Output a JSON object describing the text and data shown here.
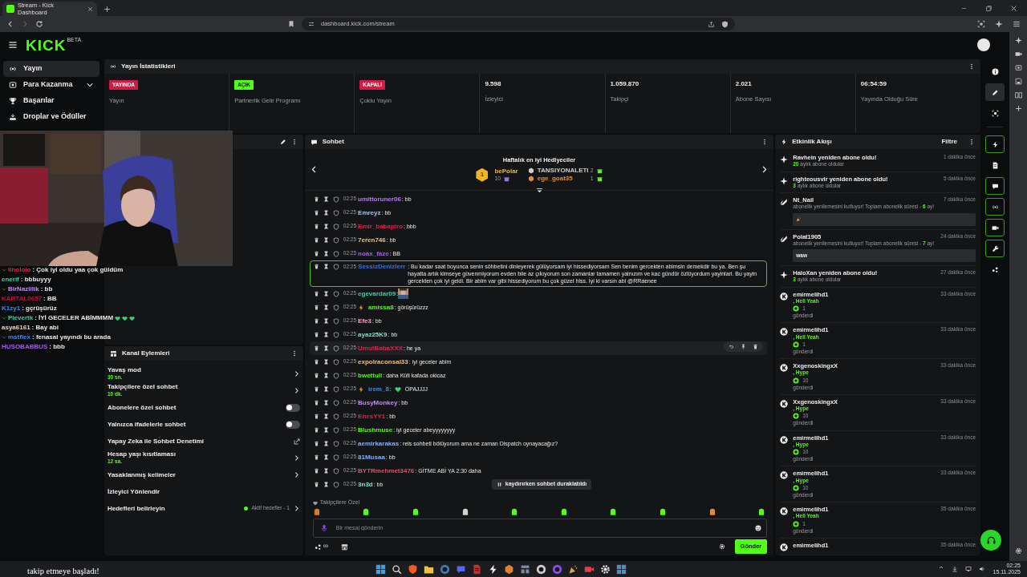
{
  "browser": {
    "tab_title": "Stream - Kick Dashboard",
    "url": "dashboard.kick.com/stream"
  },
  "header": {
    "logo": "KICK",
    "logo_badge": "BETA"
  },
  "sidebar": {
    "items": [
      {
        "kind": "broadcast",
        "label": "Yayın",
        "selected": true,
        "expandable": false
      },
      {
        "kind": "wallet",
        "label": "Para Kazanma",
        "selected": false,
        "expandable": true
      },
      {
        "kind": "trophy",
        "label": "Başarılar",
        "selected": false,
        "expandable": false
      },
      {
        "kind": "drops",
        "label": "Droplar ve Ödüller",
        "selected": false,
        "expandable": false
      }
    ]
  },
  "stats": {
    "title": "Yayın İstatistikleri",
    "cells": [
      {
        "kind": "badge",
        "value": "YAYINDA",
        "color": "#d01c44",
        "label": "Yayın"
      },
      {
        "kind": "badge",
        "value": "AÇIK",
        "color": "#53fc18",
        "label": "Partnerlik Gelir Programı"
      },
      {
        "kind": "badge",
        "value": "KAPALI",
        "color": "#d01c44",
        "label": "Çoklu Yayın"
      },
      {
        "kind": "number",
        "value": "9.598",
        "label": "İzleyici"
      },
      {
        "kind": "number",
        "value": "1.059.870",
        "label": "Takipçi"
      },
      {
        "kind": "number",
        "value": "2.021",
        "label": "Abone Sayısı"
      },
      {
        "kind": "number",
        "value": "06:54:59",
        "label": "Yayında Olduğu Süre"
      }
    ]
  },
  "rail": [
    {
      "kind": "info",
      "selected": false,
      "pinned": false
    },
    {
      "kind": "pencil",
      "selected": true,
      "pinned": false
    },
    {
      "kind": "scan",
      "selected": false,
      "pinned": false
    },
    {
      "kind": "bolt",
      "selected": false,
      "pinned": true
    },
    {
      "kind": "doc",
      "selected": false,
      "pinned": false
    },
    {
      "kind": "chat",
      "selected": false,
      "pinned": true
    },
    {
      "kind": "broadcast",
      "selected": false,
      "pinned": true
    },
    {
      "kind": "camera",
      "selected": false,
      "pinned": true
    },
    {
      "kind": "wrench",
      "selected": false,
      "pinned": true
    },
    {
      "kind": "nodes",
      "selected": false,
      "pinned": false
    }
  ],
  "webcam_overlay": {
    "chat": [
      {
        "kind": "text",
        "user": "linololo",
        "color": "#e0234e",
        "badge": true,
        "text": ": Çok iyi oldu yaa çok güldüm"
      },
      {
        "kind": "text",
        "user": "enerif",
        "color": "#3fd0a0",
        "badge": false,
        "text": ": bbbuyyy"
      },
      {
        "kind": "text",
        "user": "BirNazlilik",
        "color": "#c08cf0",
        "badge": true,
        "text": ": bb"
      },
      {
        "kind": "text",
        "user": "KARTAL0657",
        "color": "#c0143a",
        "badge": false,
        "text": ": BB"
      },
      {
        "kind": "text",
        "user": "K1zy1",
        "color": "#3a8cf0",
        "badge": false,
        "text": ": gçrüşürüz"
      },
      {
        "kind": "hearts",
        "user": "Plevertk",
        "color": "#3fd0a0",
        "badge": true,
        "text": ": İYİ GECELER ABİMMMM"
      },
      {
        "kind": "text",
        "user": "asya6161",
        "color": "#e8d0c0",
        "badge": false,
        "text": ": Bay abi"
      },
      {
        "kind": "text",
        "user": "mstflex",
        "color": "#3a8cf0",
        "badge": true,
        "text": ": fenasal yayındı bu arada"
      },
      {
        "kind": "text",
        "user": "HUSOBABBUS",
        "color": "#a35ce8",
        "badge": false,
        "text": ": bbb"
      }
    ]
  },
  "follow_alert": {
    "text": "takip etmeye başladı!"
  },
  "channel_actions": {
    "title": "Kanal Eylemleri",
    "items": [
      {
        "kind": "link",
        "label": "Yavaş mod",
        "value": "30 sn."
      },
      {
        "kind": "link",
        "label": "Takipçilere özel sohbet",
        "value": "10 dk."
      },
      {
        "kind": "toggle",
        "label": "Abonelere özel sohbet",
        "on": false
      },
      {
        "kind": "toggle",
        "label": "Yalnızca ifadelerle sohbet",
        "on": false
      },
      {
        "kind": "external",
        "label": "Yapay Zeka ile Sohbet Denetimi"
      },
      {
        "kind": "link",
        "label": "Hesap yaşı kısıtlaması",
        "value": "12 sa."
      },
      {
        "kind": "link",
        "label": "Yasaklanmış kelimeler"
      },
      {
        "kind": "plain",
        "label": "İzleyici Yönlendir"
      },
      {
        "kind": "link",
        "label": "Hedefleri belirleyin",
        "status": "Aktif hedefler - 1"
      }
    ]
  },
  "chat": {
    "title": "Sohbet",
    "gifters": {
      "title": "Haftalık en iyi Hediyeciler",
      "first": {
        "rank": "1",
        "name": "bePolar",
        "count": "10"
      },
      "others": [
        {
          "name": "TANSIYONALETI",
          "count": "2",
          "color": "#cfcfcf"
        },
        {
          "name": "ege_goat35",
          "count": "1",
          "color": "#e08a3c"
        }
      ]
    },
    "messages": [
      {
        "kind": "text",
        "time": "02:25",
        "user": "umittoruner06",
        "color": "#b57cf0",
        "badge": false,
        "text": ": bb",
        "highlighted": false,
        "hovered": false
      },
      {
        "kind": "text",
        "time": "02:25",
        "user": "Emreyz",
        "color": "#9ec3ff",
        "badge": false,
        "text": ": bb",
        "highlighted": false,
        "hovered": false
      },
      {
        "kind": "text",
        "time": "02:25",
        "user": "Emir_babapiro",
        "color": "#e0234e",
        "badge": false,
        "text": ": bbb",
        "highlighted": false,
        "hovered": false
      },
      {
        "kind": "text",
        "time": "02:25",
        "user": "7eren746",
        "color": "#f0c070",
        "badge": false,
        "text": ": bb",
        "highlighted": false,
        "hovered": false
      },
      {
        "kind": "text",
        "time": "02:25",
        "user": "noax_faze",
        "color": "#a35ce8",
        "badge": false,
        "text": ": BB",
        "highlighted": false,
        "hovered": false
      },
      {
        "kind": "text",
        "time": "02:25",
        "user": "SessizDenizlerr",
        "color": "#3a6fd8",
        "badge": false,
        "text": ": Bu kadar saat boyunca senin söhbetini dinleyerek gülüyorsam iyi hissediyorsam Sen benim gercekten abimsin demekdir bu ya. Ben şu hayatta artık kimseye güvenmiyorum evden bile az çıkıyorum son zamanlar tamamen yalnızım ve kac gündür özlüyordum yayinlari. Bu yayin gercekten çok iyi geldi. Bir abim var gibi hissediyorum bu çok güzel hiss. İyi ki varsın abi @RRaenee",
        "highlighted": true,
        "hovered": false
      },
      {
        "time": "02:25",
        "user": "egevardar09",
        "color": "#3fd0a0",
        "badge": false,
        "text": ":",
        "highlighted": false,
        "hovered": false
      },
      {
        "kind": "text",
        "time": "02:25",
        "user": "amissa8",
        "color": "#53fc18",
        "badge": true,
        "text": ": görüşürüzzz",
        "highlighted": false,
        "hovered": false
      },
      {
        "kind": "text",
        "time": "02:25",
        "user": "Efe3",
        "color": "#f0a0c0",
        "badge": false,
        "text": ": bb",
        "highlighted": false,
        "hovered": false
      },
      {
        "kind": "text",
        "time": "02:25",
        "user": "ayaz25K9",
        "color": "#7ee0d0",
        "badge": false,
        "text": ": bb",
        "highlighted": false,
        "hovered": false
      },
      {
        "kind": "text",
        "time": "02:25",
        "user": "UmutBabaXXX",
        "color": "#e0234e",
        "badge": false,
        "text": ": he ya",
        "highlighted": false,
        "hovered": true
      },
      {
        "kind": "text",
        "time": "02:25",
        "user": "expolraconsal33",
        "color": "#f0c070",
        "badge": false,
        "text": ": iyi geceler abim",
        "highlighted": false,
        "hovered": false
      },
      {
        "kind": "text",
        "time": "02:25",
        "user": "bwettull",
        "color": "#53fc18",
        "badge": false,
        "text": ": daha Küfi kafada okicaz",
        "highlighted": false,
        "hovered": false
      },
      {
        "kind": "heart",
        "time": "02:25",
        "user": "irem_8",
        "color": "#3a8cf0",
        "badge": true,
        "text": ":",
        "after": "ÖPAJJJJ",
        "highlighted": false,
        "hovered": false
      },
      {
        "kind": "text",
        "time": "02:25",
        "user": "BusyMonkey",
        "color": "#c08cf0",
        "badge": false,
        "text": ": bb",
        "highlighted": false,
        "hovered": false
      },
      {
        "kind": "text",
        "time": "02:25",
        "user": "EnesYY1",
        "color": "#e0234e",
        "badge": false,
        "text": ": bb",
        "highlighted": false,
        "hovered": false
      },
      {
        "kind": "text",
        "time": "02:25",
        "user": "Blushmuse",
        "color": "#53fc18",
        "badge": false,
        "text": ": iyi geceler abeyyyyyyyy",
        "highlighted": false,
        "hovered": false
      },
      {
        "kind": "text",
        "time": "02:25",
        "user": "aemirkarakas",
        "color": "#7eb0ff",
        "badge": false,
        "text": ": reis sohbeti bölüyorum ama ne zaman Dispatch oynayacağız?",
        "highlighted": false,
        "hovered": false
      },
      {
        "kind": "text",
        "time": "02:25",
        "user": "81Musaa",
        "color": "#7eb0ff",
        "badge": false,
        "text": ": bb",
        "highlighted": false,
        "hovered": false
      },
      {
        "kind": "text",
        "time": "02:25",
        "user": "BYTRmehmet3476",
        "color": "#e05070",
        "badge": false,
        "text": ": GİTME ABİ YA 2:30 daha",
        "highlighted": false,
        "hovered": false
      },
      {
        "kind": "text",
        "time": "02:25",
        "user": "3n3d",
        "color": "#7ee0d0",
        "badge": false,
        "text": ": bb",
        "highlighted": false,
        "hovered": false
      }
    ],
    "paused_notice": "kaydırırken sohbet duraklatıldı",
    "emote_label": "Takipçilere Özel",
    "input_placeholder": "Bir mesaj gönderin",
    "points_label": "∞",
    "send": "Gönder"
  },
  "activity": {
    "title": "Etkinlik Akışı",
    "filter": "Filtre",
    "items": [
      {
        "kind": "resub",
        "title": "Ravhein yeniden abone oldu!",
        "detail": "**20** aylık abone oldular",
        "time": "1 dakika önce"
      },
      {
        "kind": "resub",
        "title": "righteousvlr yeniden abone oldu!",
        "detail": "**3** aylık abone oldular",
        "time": "5 dakika önce"
      },
      {
        "kind": "renewal_emote",
        "title": "Nt_Nail",
        "detail": "abonelik yenilemesini kutluyor! Toplam abonelik süresi - **6** ay!",
        "time": "7 dakika önce"
      },
      {
        "kind": "renewal",
        "title": "Polat1905",
        "detail": "abonelik yenilemesini kutluyor! Toplam abonelik süresi - **7** ay!",
        "time": "24 dakika önce",
        "message": "waw"
      },
      {
        "kind": "resub",
        "title": "HaloXan yeniden abone oldu!",
        "detail": "**3** aylık abone oldular",
        "time": "27 dakika önce"
      },
      {
        "kind": "gift",
        "title": "emirmelihd1",
        "gift": ", Hell Yeah",
        "amount": "1",
        "sent": "gönderdi",
        "time": "33 dakika önce"
      },
      {
        "kind": "gift",
        "title": "emirmelihd1",
        "gift": ", Hell Yeah",
        "amount": "1",
        "sent": "gönderdi",
        "time": "33 dakika önce"
      },
      {
        "kind": "gift",
        "title": "XxgenoskingxX",
        "gift": ", Hype",
        "amount": "10",
        "sent": "gönderdi",
        "time": "33 dakika önce"
      },
      {
        "kind": "gift",
        "title": "XxgenoskingxX",
        "gift": ", Hype",
        "amount": "10",
        "sent": "gönderdi",
        "time": "33 dakika önce"
      },
      {
        "kind": "gift",
        "title": "emirmelihd1",
        "gift": ", Hype",
        "amount": "10",
        "sent": "gönderdi",
        "time": "33 dakika önce"
      },
      {
        "kind": "gift",
        "title": "emirmelihd1",
        "gift": ", Hype",
        "amount": "10",
        "sent": "gönderdi",
        "time": "33 dakika önce"
      },
      {
        "kind": "gift",
        "title": "emirmelihd1",
        "gift": ", Hell Yeah",
        "amount": "1",
        "sent": "gönderdi",
        "time": "35 dakika önce"
      },
      {
        "kind": "gift",
        "title": "emirmelihd1",
        "time": "35 dakika önce"
      }
    ]
  },
  "taskbar": {
    "time": "02:25",
    "date": "15.11.2025"
  }
}
